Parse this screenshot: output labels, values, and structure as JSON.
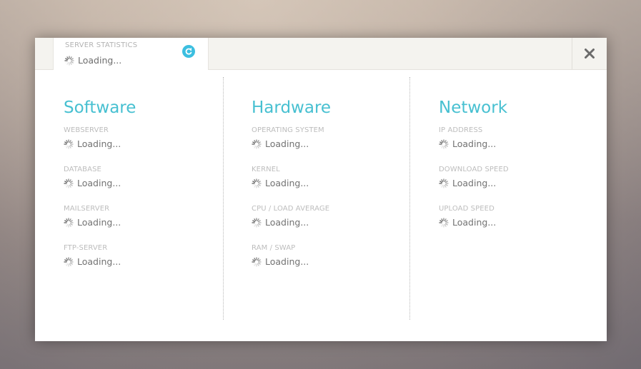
{
  "tab": {
    "title": "SERVER STATISTICS",
    "value": "Loading...",
    "refresh_icon": "refresh-icon"
  },
  "close_icon": "close-icon",
  "colors": {
    "accent": "#47c0d1",
    "refresh_button": "#3cbfe0",
    "label": "#bdbdbd",
    "value": "#727272"
  },
  "columns": [
    {
      "heading": "Software",
      "fields": [
        {
          "label": "WEBSERVER",
          "value": "Loading..."
        },
        {
          "label": "DATABASE",
          "value": "Loading..."
        },
        {
          "label": "MAILSERVER",
          "value": "Loading..."
        },
        {
          "label": "FTP-SERVER",
          "value": "Loading..."
        }
      ]
    },
    {
      "heading": "Hardware",
      "fields": [
        {
          "label": "OPERATING SYSTEM",
          "value": "Loading..."
        },
        {
          "label": "KERNEL",
          "value": "Loading..."
        },
        {
          "label": "CPU / LOAD AVERAGE",
          "value": "Loading..."
        },
        {
          "label": "RAM / SWAP",
          "value": "Loading..."
        }
      ]
    },
    {
      "heading": "Network",
      "fields": [
        {
          "label": "IP ADDRESS",
          "value": "Loading..."
        },
        {
          "label": "DOWNLOAD SPEED",
          "value": "Loading..."
        },
        {
          "label": "UPLOAD SPEED",
          "value": "Loading..."
        }
      ]
    }
  ]
}
